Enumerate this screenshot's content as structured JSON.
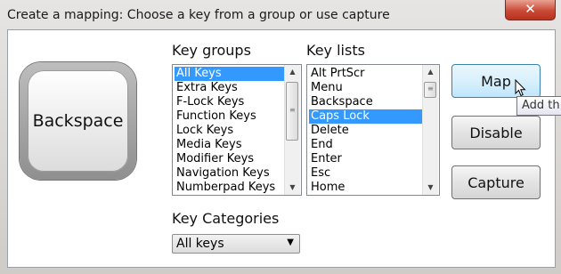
{
  "window": {
    "title": "Create a mapping: Choose a key from a group or use capture",
    "close_glyph": "✕"
  },
  "key_preview": {
    "label": "Backspace"
  },
  "key_groups": {
    "label": "Key groups",
    "items": [
      {
        "label": "All Keys",
        "selected": true
      },
      {
        "label": "Extra Keys",
        "selected": false
      },
      {
        "label": "F-Lock Keys",
        "selected": false
      },
      {
        "label": "Function Keys",
        "selected": false
      },
      {
        "label": "Lock Keys",
        "selected": false
      },
      {
        "label": "Media Keys",
        "selected": false
      },
      {
        "label": "Modifier Keys",
        "selected": false
      },
      {
        "label": "Navigation Keys",
        "selected": false
      },
      {
        "label": "Numberpad Keys",
        "selected": false
      }
    ]
  },
  "key_lists": {
    "label": "Key lists",
    "items": [
      {
        "label": "Alt PrtScr",
        "selected": false
      },
      {
        "label": "Menu",
        "selected": false
      },
      {
        "label": "Backspace",
        "selected": false
      },
      {
        "label": "Caps Lock",
        "selected": true
      },
      {
        "label": "Delete",
        "selected": false
      },
      {
        "label": "End",
        "selected": false
      },
      {
        "label": "Enter",
        "selected": false
      },
      {
        "label": "Esc",
        "selected": false
      },
      {
        "label": "Home",
        "selected": false
      }
    ]
  },
  "key_categories": {
    "label": "Key Categories",
    "selected": "All keys"
  },
  "buttons": {
    "map": "Map",
    "disable": "Disable",
    "capture": "Capture"
  },
  "tooltip": {
    "text": "Add th"
  },
  "icons": {
    "scroll_up": "▲",
    "scroll_down": "▼",
    "dropdown": "▼",
    "grip": "≡"
  }
}
